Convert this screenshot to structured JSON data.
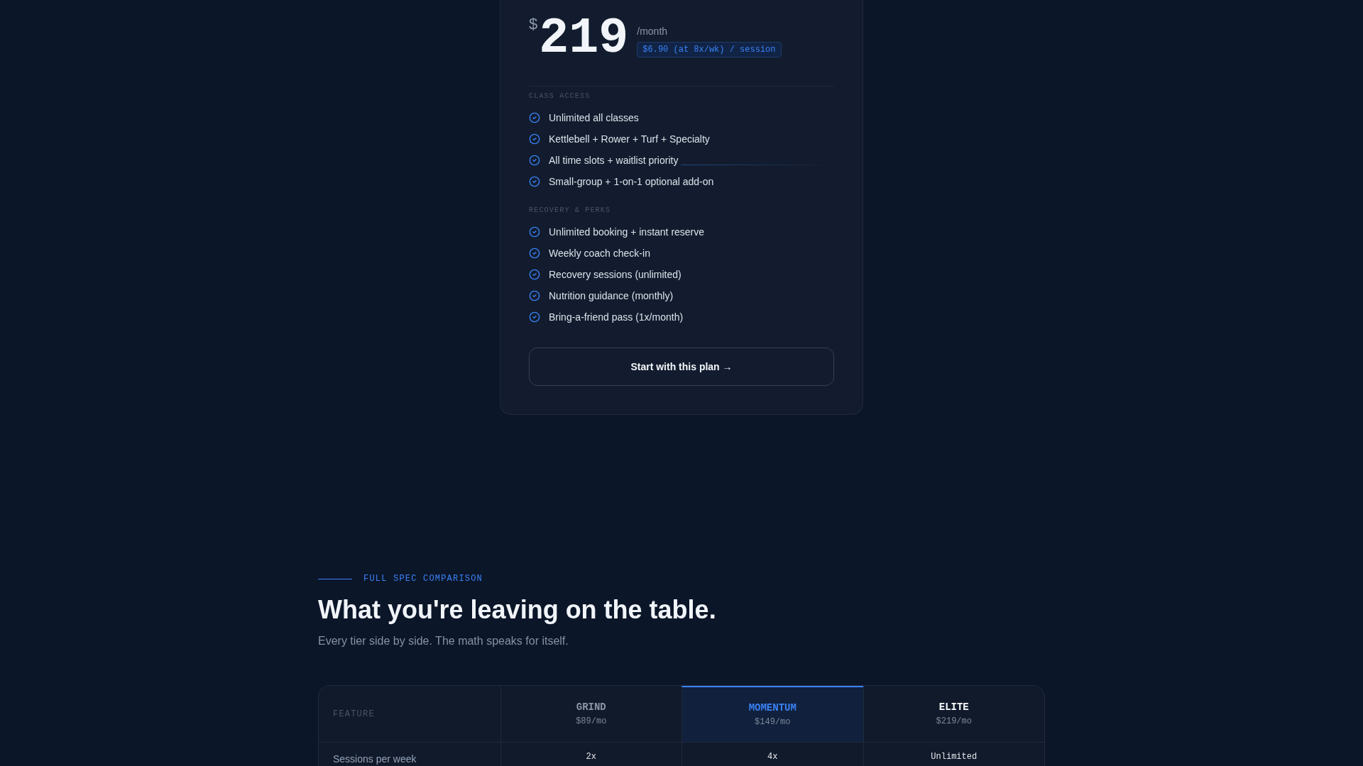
{
  "plan_card": {
    "currency": "$",
    "price": "219",
    "period": "/month",
    "per_session_badge": "$6.90 (at 8x/wk) / session",
    "feature_groups": [
      {
        "title": "CLASS ACCESS",
        "items": [
          "Unlimited all classes",
          "Kettlebell + Rower + Turf + Specialty",
          "All time slots + waitlist priority",
          "Small-group + 1-on-1 optional add-on"
        ]
      },
      {
        "title": "RECOVERY & PERKS",
        "items": [
          "Unlimited booking + instant reserve",
          "Weekly coach check-in",
          "Recovery sessions (unlimited)",
          "Nutrition guidance (monthly)",
          "Bring-a-friend pass (1x/month)"
        ]
      }
    ],
    "cta": "Start with this plan →"
  },
  "comparison": {
    "eyebrow": "FULL SPEC COMPARISON",
    "title": "What you're leaving on the table.",
    "subtitle": "Every tier side by side. The math speaks for itself.",
    "table": {
      "feature_header": "FEATURE",
      "tiers": [
        {
          "name": "GRIND",
          "price": "$89/mo",
          "kind": "standard"
        },
        {
          "name": "MOMENTUM",
          "price": "$149/mo",
          "kind": "featured"
        },
        {
          "name": "ELITE",
          "price": "$219/mo",
          "kind": "top"
        }
      ],
      "rows": [
        {
          "feature": "Sessions per week",
          "values": [
            "2x",
            "4x",
            "Unlimited"
          ]
        }
      ]
    }
  }
}
